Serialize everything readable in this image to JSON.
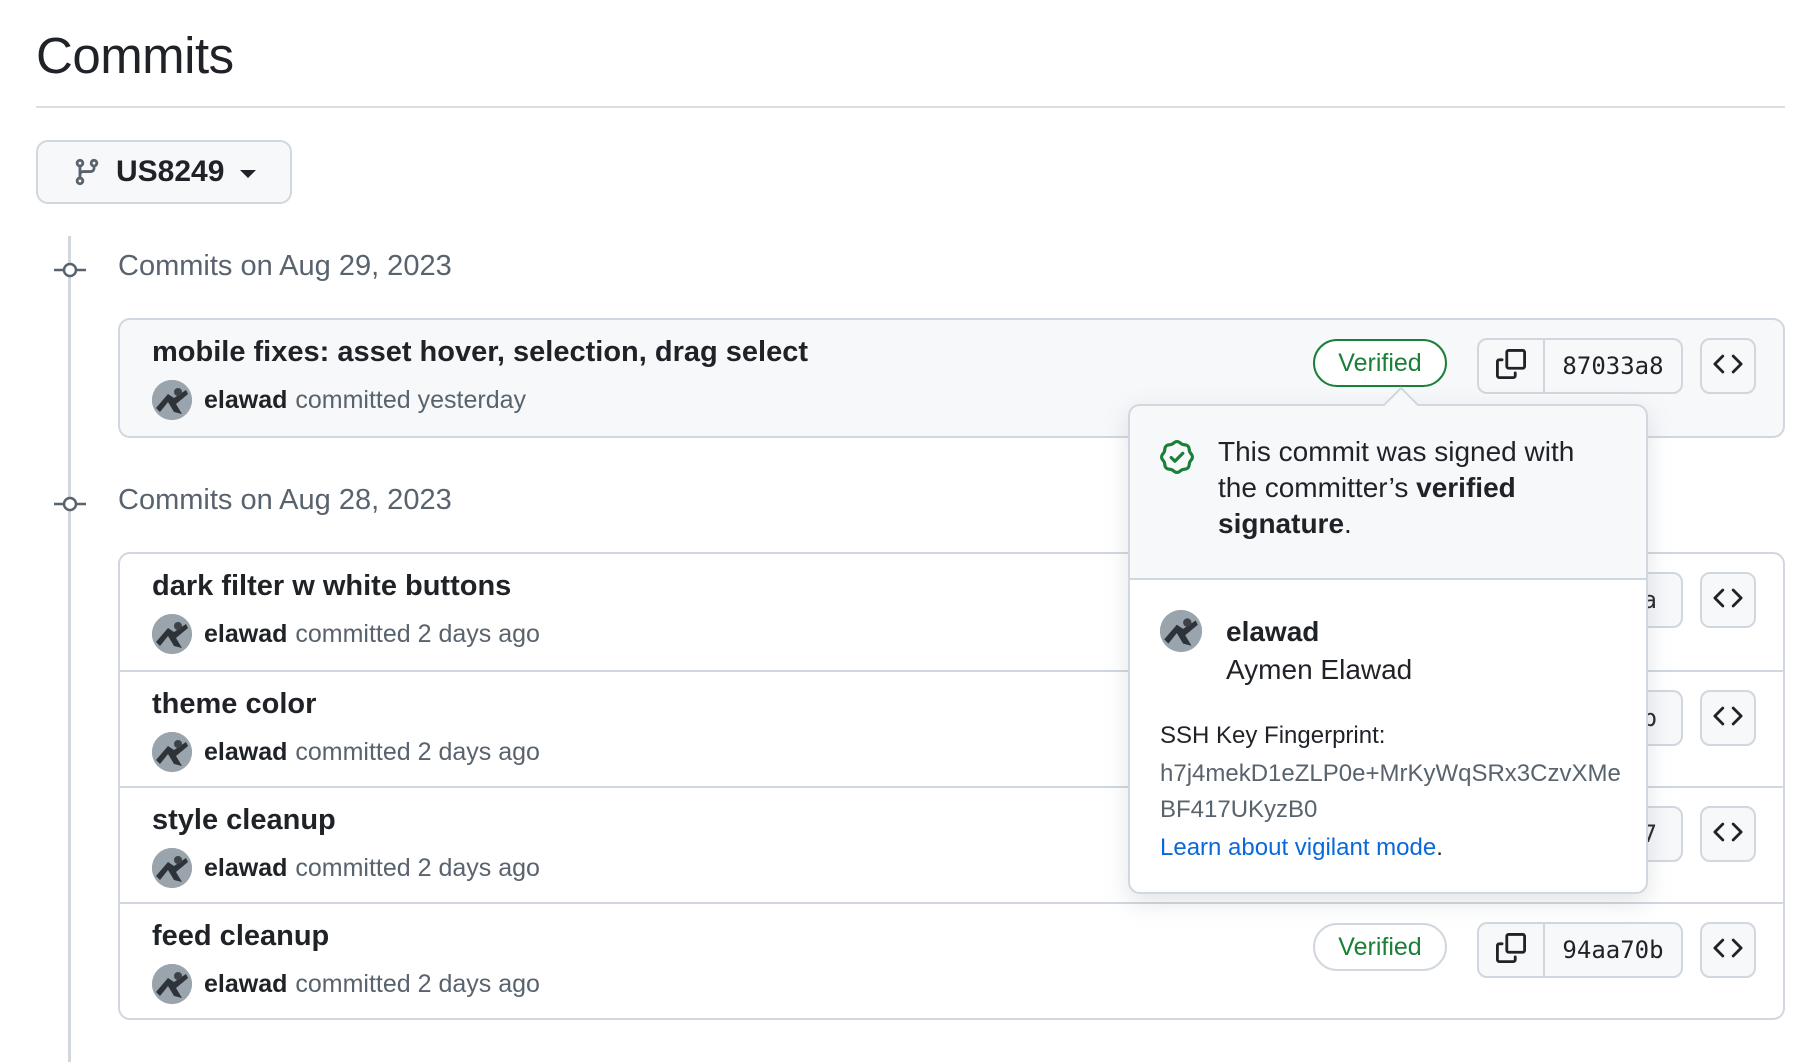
{
  "page": {
    "title": "Commits"
  },
  "branch": {
    "name": "US8249"
  },
  "groups": [
    {
      "date_label": "Commits on Aug 29, 2023",
      "commits": [
        {
          "title": "mobile fixes: asset hover, selection, drag select",
          "author": "elawad",
          "time": "committed yesterday",
          "verified": "Verified",
          "sha": "87033a8"
        }
      ]
    },
    {
      "date_label": "Commits on Aug 28, 2023",
      "commits": [
        {
          "title": "dark filter w white buttons",
          "author": "elawad",
          "time": "committed 2 days ago",
          "sha_partial": "a"
        },
        {
          "title": "theme color",
          "author": "elawad",
          "time": "committed 2 days ago",
          "sha_partial": "b"
        },
        {
          "title": "style cleanup",
          "author": "elawad",
          "time": "committed 2 days ago",
          "sha_partial": "7"
        },
        {
          "title": "feed cleanup",
          "author": "elawad",
          "time": "committed 2 days ago",
          "verified": "Verified",
          "sha": "94aa70b"
        }
      ]
    }
  ],
  "popover": {
    "signed_prefix": "This commit was signed with the committer’s ",
    "signed_bold": "verified signature",
    "signed_suffix": ".",
    "login": "elawad",
    "full_name": "Aymen Elawad",
    "fingerprint_label": "SSH Key Fingerprint:",
    "fingerprint": "h7j4mekD1eZLP0e+MrKyWqSRx3CzvXMeBF417UKyzB0",
    "learn_link": "Learn about vigilant mode",
    "learn_suffix": "."
  },
  "colors": {
    "verified_green": "#1a7f37",
    "link_blue": "#0969da",
    "muted_text": "#59636e",
    "border": "#d0d7de"
  },
  "icons": [
    "git-branch-icon",
    "caret-down-icon",
    "git-commit-icon",
    "copy-icon",
    "code-icon",
    "verified-check-icon"
  ]
}
